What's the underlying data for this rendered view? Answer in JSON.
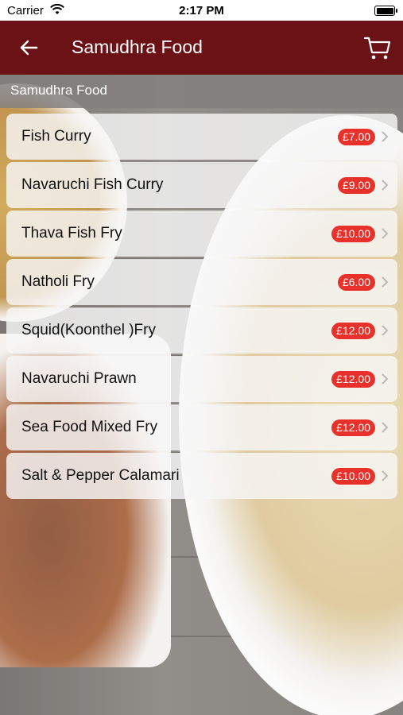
{
  "status_bar": {
    "carrier": "Carrier",
    "time": "2:17 PM"
  },
  "navbar": {
    "title": "Samudhra Food"
  },
  "section": {
    "title": "Samudhra Food"
  },
  "menu": {
    "items": [
      {
        "name": "Fish Curry",
        "price": "£7.00"
      },
      {
        "name": "Navaruchi Fish Curry",
        "price": "£9.00"
      },
      {
        "name": "Thava Fish Fry",
        "price": "£10.00"
      },
      {
        "name": "Natholi Fry",
        "price": "£6.00"
      },
      {
        "name": "Squid(Koonthel )Fry",
        "price": "£12.00"
      },
      {
        "name": "Navaruchi Prawn",
        "price": "£12.00"
      },
      {
        "name": "Sea Food Mixed Fry",
        "price": "£12.00"
      },
      {
        "name": "Salt & Pepper Calamari",
        "price": "£10.00"
      }
    ]
  },
  "colors": {
    "navbar": "#6b1216",
    "price_badge": "#e8312a"
  },
  "icons": {
    "back": "arrow-left-icon",
    "cart": "cart-icon",
    "chevron": "chevron-right-icon",
    "wifi": "wifi-icon",
    "battery": "battery-icon"
  }
}
